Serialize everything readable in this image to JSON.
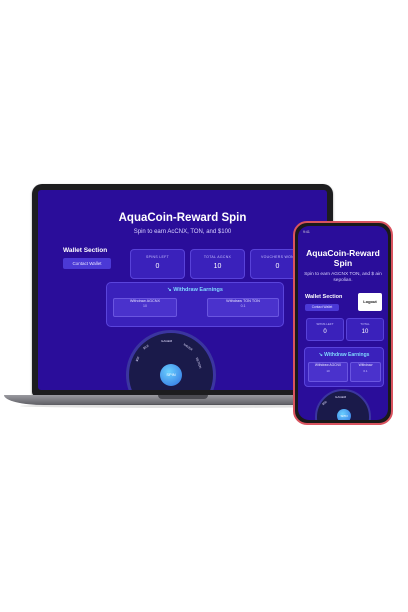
{
  "laptop": {
    "title": "AquaCoin-Reward Spin",
    "subtitle": "Spin to earn AcCNX, TON, and $100",
    "wallet_label": "Wallet Section",
    "contact_button": "Contact Wallet",
    "stats": [
      {
        "label": "SPINS LEFT",
        "value": "0"
      },
      {
        "label": "TOTAL AGCNX",
        "value": "10"
      },
      {
        "label": "VOUCHERS WON",
        "value": "0"
      }
    ],
    "withdraw_title": "Withdraw Earnings",
    "withdraw_buttons": [
      {
        "label": "Withdraw AGCNX",
        "value": "10"
      },
      {
        "label": "Withdraw TON TON",
        "value": "0.1"
      }
    ],
    "wheel_labels": [
      "$50",
      "GAGEM",
      "NAVER",
      "$0.6",
      "RETION"
    ],
    "spin_label": "SPIN"
  },
  "phone": {
    "status_time": "9:41",
    "title": "AquaCoin-Reward Spin",
    "subtitle": "Spin to earn AGCNX TON, and $ ain sepolian.",
    "wallet_label": "Wallet Section",
    "contact_button": "Contact Wallet",
    "logout_button": "Logout",
    "stats": [
      {
        "label": "SPINS LEFT",
        "value": "0"
      },
      {
        "label": "TOTAL",
        "value": "10"
      }
    ],
    "withdraw_title": "Withdraw Earnings",
    "withdraw_buttons": [
      {
        "label": "Withdraw AGCNX",
        "value": "10"
      },
      {
        "label": "Withdraw",
        "value": "0.1"
      }
    ],
    "wheel_labels": [
      "GAGEM",
      "$50"
    ],
    "spin_label": "SPIN"
  },
  "colors": {
    "screen_bg": "#2a0d9a",
    "accent": "#7fd7ff",
    "phone_frame": "#d9535f"
  }
}
